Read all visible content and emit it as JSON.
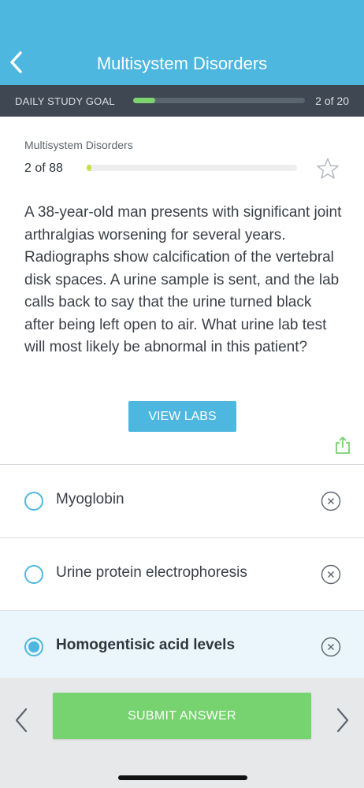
{
  "header": {
    "title": "Multisystem Disorders",
    "back_icon": "chevron-left-icon"
  },
  "study_goal": {
    "label": "DAILY STUDY GOAL",
    "count": "2 of 20",
    "progress": 0.13
  },
  "question": {
    "category": "Multisystem Disorders",
    "count": "2 of 88",
    "progress": 0.023,
    "text": "A 38-year-old man presents with significant joint arthralgias worsening for several years. Radiographs show calcification of the vertebral disk spaces. A urine sample is sent, and the lab calls back to say that the urine turned black after being left open to air. What urine lab test will most likely be abnormal in this patient?",
    "labs_button": "VIEW LABS"
  },
  "options": [
    {
      "label": "Myoglobin",
      "selected": false
    },
    {
      "label": "Urine protein electrophoresis",
      "selected": false
    },
    {
      "label": "Homogentisic acid levels",
      "selected": true
    }
  ],
  "footer": {
    "submit_label": "SUBMIT ANSWER"
  },
  "colors": {
    "accent": "#4db7e0",
    "success": "#76d36f",
    "goal_bar": "#3f4852",
    "selected_bg": "#eaf6fb"
  }
}
